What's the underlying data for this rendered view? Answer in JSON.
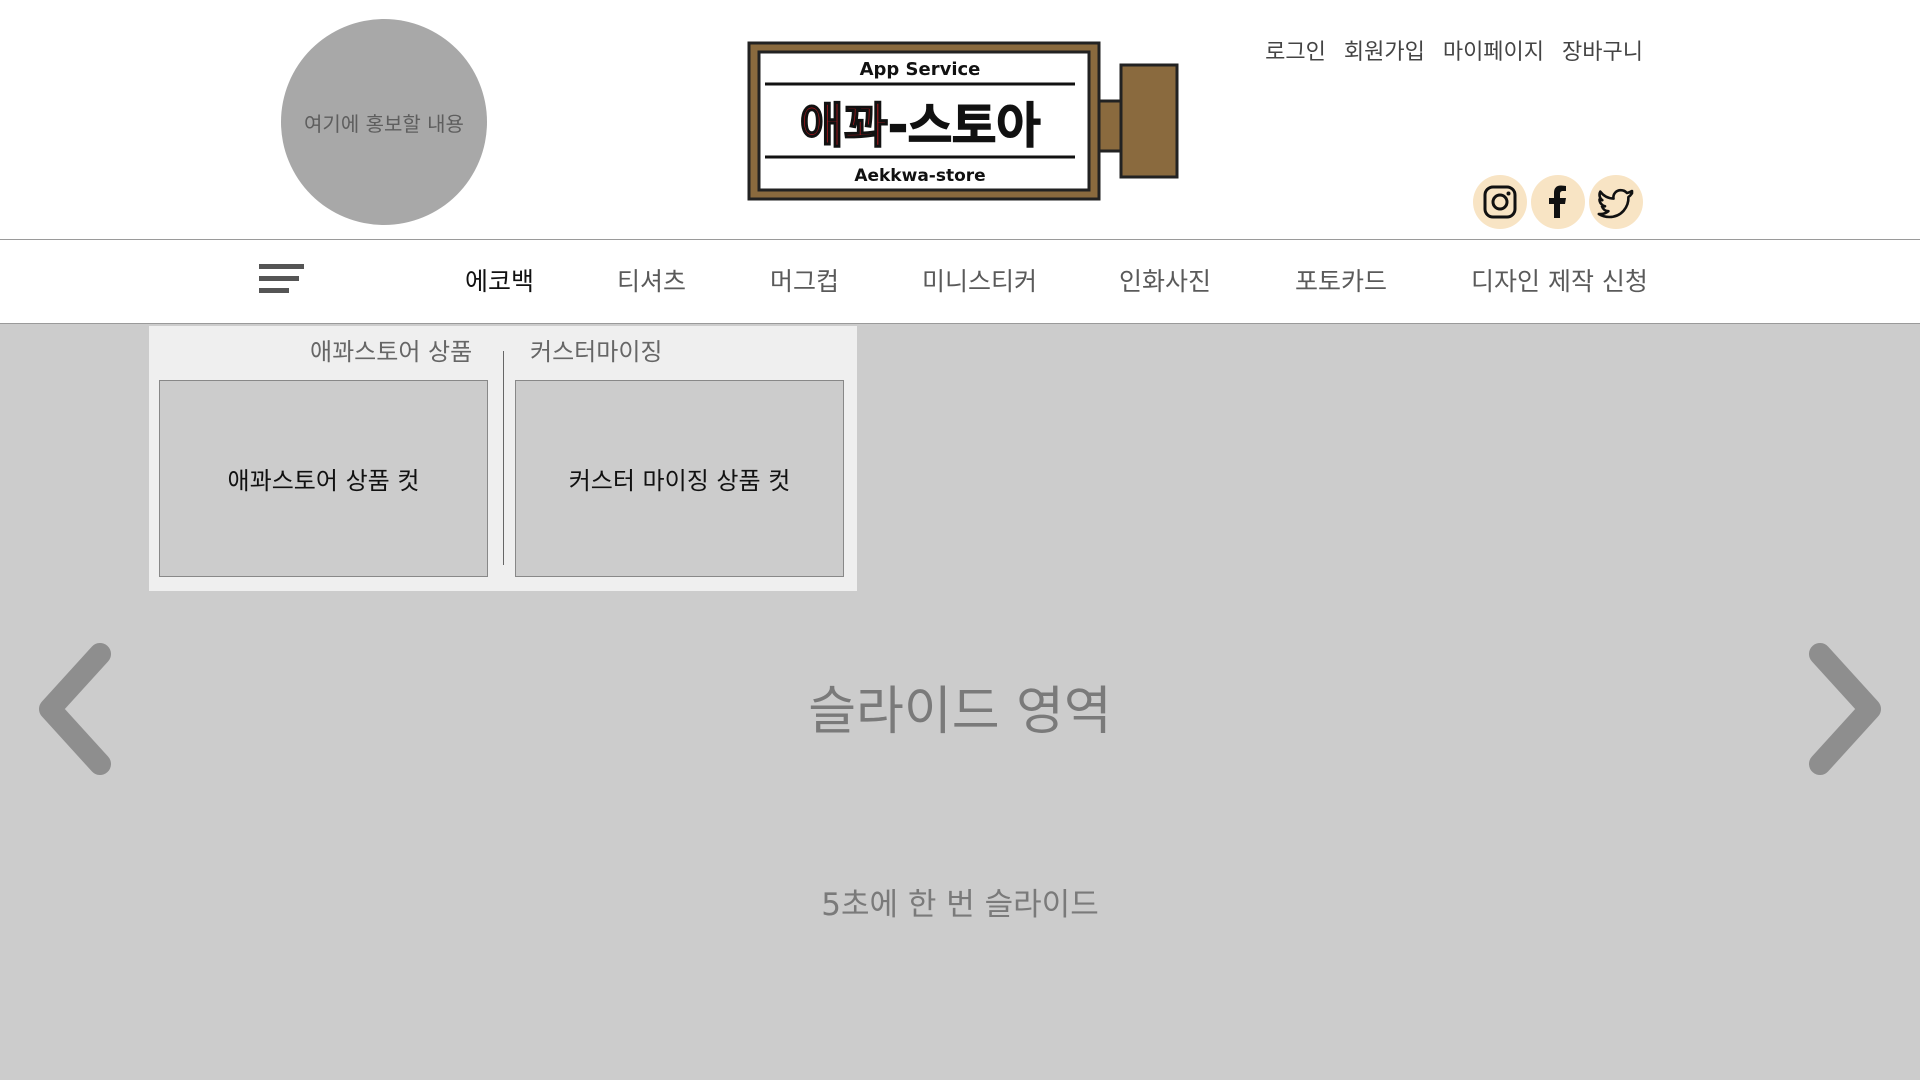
{
  "header": {
    "promo_text": "여기에 홍보할 내용",
    "logo": {
      "top_text": "App Service",
      "main_red": "애꽈",
      "main_black": "-스토아",
      "bottom_text": "Aekkwa-store"
    },
    "util_links": [
      "로그인",
      "회원가입",
      "마이페이지",
      "장바구니"
    ],
    "social_icons": [
      "instagram-icon",
      "facebook-icon",
      "twitter-icon"
    ]
  },
  "nav": {
    "items": [
      "에코백",
      "티셔츠",
      "머그컵",
      "미니스티커",
      "인화사진",
      "포토카드",
      "디자인 제작 신청"
    ],
    "active_index": 0
  },
  "dropdown": {
    "left_heading": "애꽈스토어 상품",
    "right_heading": "커스터마이징",
    "left_box": "애꽈스토어 상품 컷",
    "right_box": "커스터 마이징 상품 컷"
  },
  "slide": {
    "title": "슬라이드 영역",
    "subtitle": "5초에 한 번 슬라이드"
  },
  "colors": {
    "logo_frame": "#8a6a3e",
    "logo_red": "#b3171d",
    "social_bg": "#f8e4c4",
    "slide_bg": "#cccccc"
  }
}
